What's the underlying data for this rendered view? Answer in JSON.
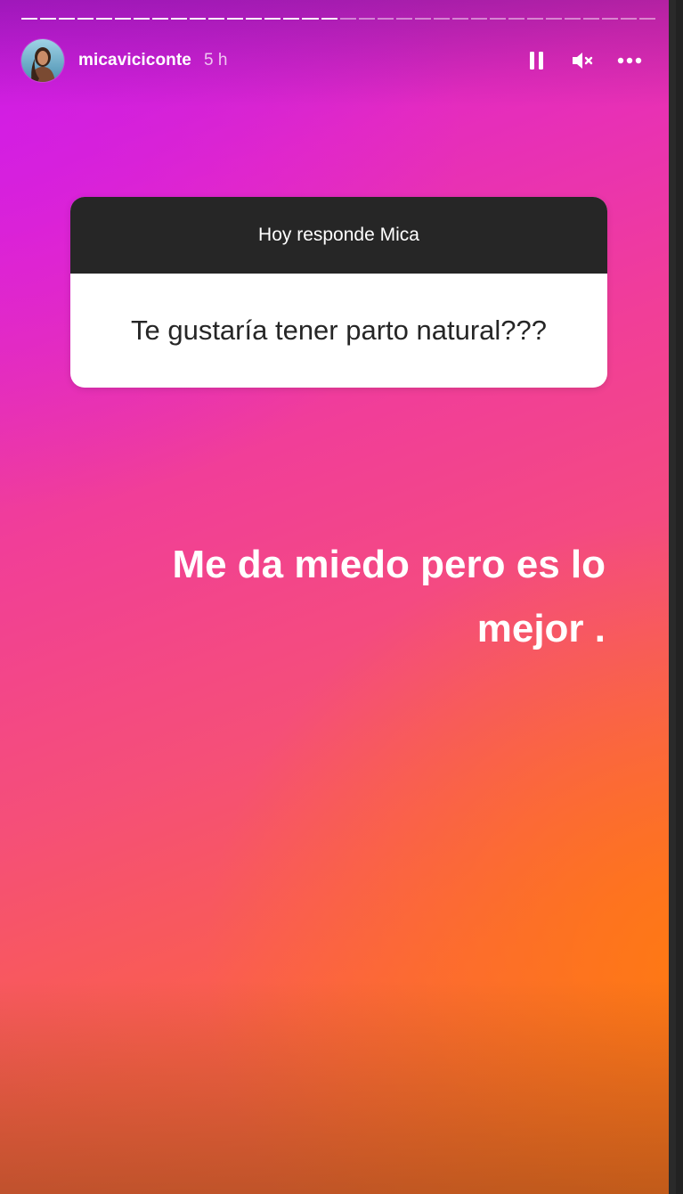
{
  "header": {
    "username": "micaviciconte",
    "time": "5 h",
    "progress_segments_total": 34,
    "progress_segments_done": 17
  },
  "icons": {
    "pause": "pause-icon",
    "mute": "mute-icon",
    "more": "more-options-icon",
    "avatar": "avatar"
  },
  "question_sticker": {
    "title": "Hoy responde Mica",
    "question": "Te gustaría tener parto natural???"
  },
  "answer": {
    "line1": "Me da miedo pero es lo",
    "line2": "mejor ."
  },
  "colors": {
    "gradient_top": "#d61ce8",
    "gradient_mid": "#f13e98",
    "gradient_bottom": "#fb6e2c",
    "sticker_header": "#262626",
    "sticker_body": "#ffffff"
  }
}
